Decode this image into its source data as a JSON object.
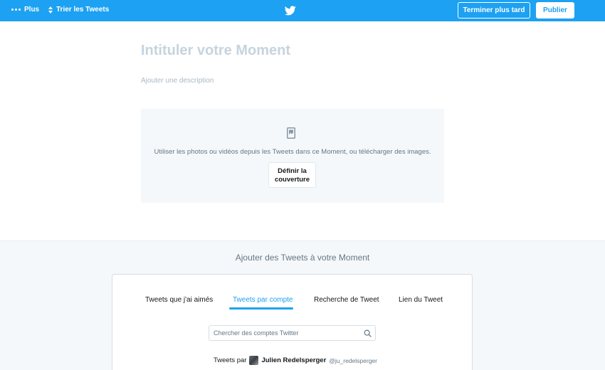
{
  "topbar": {
    "more_label": "Plus",
    "sort_label": "Trier les Tweets",
    "finish_later_label": "Terminer plus tard",
    "publish_label": "Publier",
    "brand_color": "#1da1f2"
  },
  "moment": {
    "title_placeholder": "Intituler votre Moment",
    "description_placeholder": "Ajouter une description"
  },
  "cover": {
    "help_text": "Utiliser les photos ou vidéos depuis les Tweets dans ce Moment, ou télécharger des images.",
    "set_cover_line1": "Définir la",
    "set_cover_line2": "couverture"
  },
  "add_tweets": {
    "title": "Ajouter des Tweets à votre Moment",
    "tabs": [
      {
        "label": "Tweets que j'ai aimés",
        "active": false
      },
      {
        "label": "Tweets par compte",
        "active": true
      },
      {
        "label": "Recherche de Tweet",
        "active": false
      },
      {
        "label": "Lien du Tweet",
        "active": false
      }
    ],
    "search_placeholder": "Chercher des comptes Twitter",
    "tweets_by_prefix": "Tweets par",
    "author_name": "Julien Redelsperger",
    "author_handle": "@ju_redelsperger"
  },
  "icons": [
    "more-dots-icon",
    "sort-arrows-icon",
    "twitter-bird-icon",
    "photo-icon",
    "search-icon"
  ]
}
